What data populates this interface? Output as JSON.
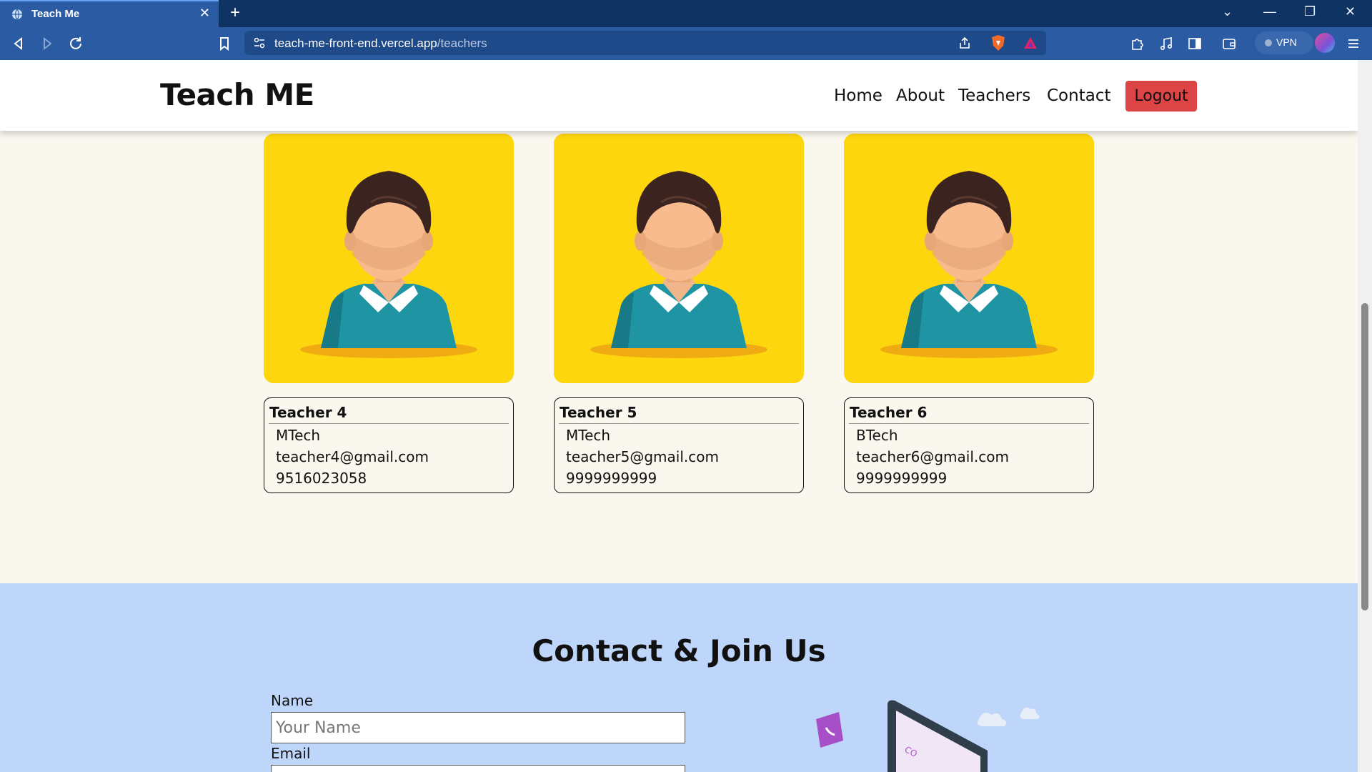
{
  "browser": {
    "tab_title": "Teach Me",
    "new_tab_symbol": "+",
    "url_host": "teach-me-front-end.vercel.app",
    "url_path": "/teachers",
    "vpn_label": "VPN"
  },
  "header": {
    "brand": "Teach ME",
    "nav": [
      "Home",
      "About",
      "Teachers",
      "Contact"
    ],
    "logout_label": "Logout"
  },
  "teachers": [
    {
      "name": "Teacher 4",
      "degree": "MTech",
      "email": "teacher4@gmail.com",
      "phone": "9516023058"
    },
    {
      "name": "Teacher 5",
      "degree": "MTech",
      "email": "teacher5@gmail.com",
      "phone": "9999999999"
    },
    {
      "name": "Teacher 6",
      "degree": "BTech",
      "email": "teacher6@gmail.com",
      "phone": "9999999999"
    }
  ],
  "contact": {
    "title": "Contact & Join Us",
    "name_label": "Name",
    "name_placeholder": "Your Name",
    "email_label": "Email"
  },
  "colors": {
    "header_bg": "#ffffff",
    "page_bg": "#faf7ef",
    "card_image_bg": "#fed60d",
    "logout_bg": "#dc4446",
    "contact_bg": "#bfd6fb",
    "browser_bar": "#2a5ba3"
  },
  "icons": [
    "globe-icon",
    "close-icon",
    "plus-icon",
    "back-icon",
    "forward-icon",
    "reload-icon",
    "bookmark-icon",
    "site-settings-icon",
    "share-icon",
    "brave-shield-icon",
    "rewards-icon",
    "extensions-icon",
    "music-icon",
    "sidebar-icon",
    "wallet-icon",
    "menu-icon"
  ]
}
